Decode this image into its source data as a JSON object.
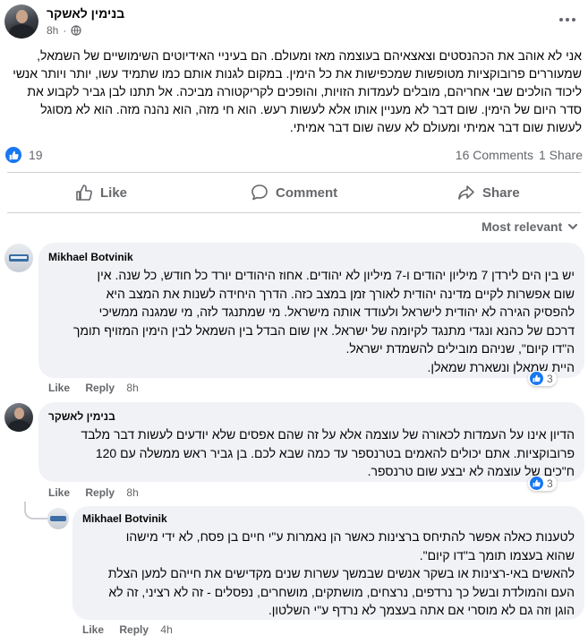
{
  "post": {
    "author": "בנימין לאשקר",
    "time": "8h",
    "text": "אני לא אוהב את הכהנסטים וצאצאיהם בעוצמה מאז ומעולם. הם בעיניי האידיוטים השימושיים של השמאל, שמעוררים פרובוקציות מטופשות שמכפישות את כל הימין. במקום לגנות אותם כמו שתמיד עשו, יותר ויותר אנשי ליכוד הולכים שבי אחריהם, מובלים לעמדות הזויות, והופכים לקריקטורה מביכה. אל תתנו לבן גביר לקבוע את סדר היום של הימין. שום דבר לא מעניין אותו אלא לעשות רעש. הוא חי מזה, הוא נהנה מזה. הוא לא מסוגל לעשות שום דבר אמיתי ומעולם לא עשה שום דבר אמיתי.",
    "reactions_count": "19",
    "comments_count": "16 Comments",
    "shares_count": "1 Share"
  },
  "actions": {
    "like": "Like",
    "comment": "Comment",
    "share": "Share"
  },
  "sort_label": "Most relevant",
  "comments": [
    {
      "author": "Mikhael Botvinik",
      "lines": [
        "יש בין הים לירדן 7 מיליון יהודים ו-7 מיליון לא יהודים. אחוז היהודים יורד כל חודש, כל שנה. אין",
        "שום אפשרות לקיים מדינה יהודית לאורך זמן במצב כזה. הדרך היחידה לשנות את המצב היא",
        "להפסיק הגירה לא יהודית לישראל ולעודד אותה מישראל. מי שמתנגד לזה, מי שמגנה ממשיכי",
        "דרכם של כהנא ונגדי מתנגד לקיומה של ישראל. אין שום הבדל בין השמאל לבין הימין המזויף תומך",
        "ה\"דו קיום\", שניהם מובילים להשמדת ישראל.",
        "היית שמאלן ונשארת שמאלן."
      ],
      "like": "Like",
      "reply": "Reply",
      "time": "8h",
      "reactions": "3"
    },
    {
      "author": "בנימין לאשקר",
      "lines": [
        "הדיון אינו על העמדות לכאורה של עוצמה אלא על זה שהם אפסים שלא יודעים לעשות דבר מלבד",
        "פרובוקציות. אתם יכולים להאמים בטרנספר עד כמה שבא לכם. בן גביר ראש ממשלה עם 120",
        "ח\"כים של עוצמה לא יבצע שום טרנספר."
      ],
      "like": "Like",
      "reply": "Reply",
      "time": "8h",
      "reactions": "3"
    },
    {
      "author": "Mikhael Botvinik",
      "lines": [
        "לטענות כאלה אפשר להתיחס ברצינות כאשר הן נאמרות ע\"י חיים בן פסח, לא ידי מישהו",
        "שהוא בעצמו תומך ב\"דו קיום\".",
        "להאשים באי-רצינות או בשקר אנשים שבמשך עשרות שנים מקדישים את חייהם למען הצלת",
        "העם והמולדת ובשל כך נרדפים, נרצחים, מושתקים, מושחרים, נפסלים - זה לא רציני, זה לא",
        "הוגן וזה גם לא מוסרי אם אתה בעצמך לא נרדף ע\"י השלטון."
      ],
      "like": "Like",
      "reply": "Reply",
      "time": "4h"
    }
  ],
  "colors": {
    "accent": "#1877f2",
    "bubble": "#f0f2f5",
    "muted": "#65676b"
  },
  "icons": [
    "avatar",
    "more-dots-icon",
    "like-reaction-icon",
    "thumbs-up-icon",
    "comment-icon",
    "share-icon",
    "chevron-down-icon"
  ]
}
